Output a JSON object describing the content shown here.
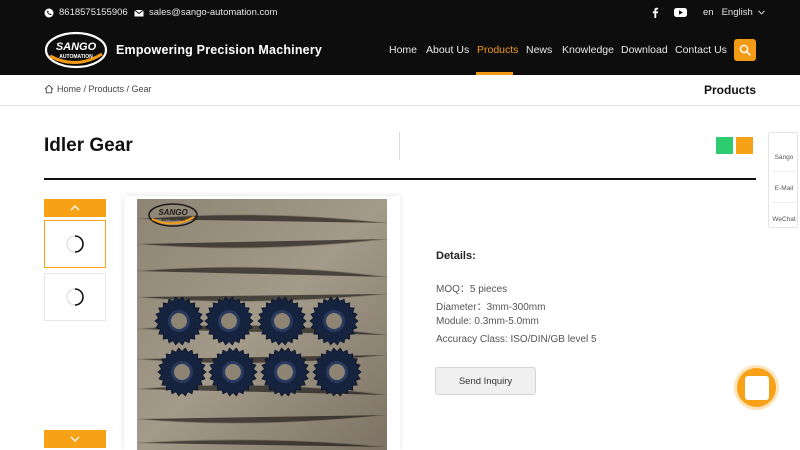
{
  "topbar": {
    "phone": "8618575155906",
    "email": "sales@sango-automation.com",
    "lang_code": "en",
    "lang_label": "English"
  },
  "brand": {
    "logo_text_top": "SANGO",
    "logo_text_bottom": "AUTOMATION",
    "slogan": "Empowering Precision Machinery",
    "accent_color": "#f49b16"
  },
  "nav": {
    "items": [
      "Home",
      "About Us",
      "Products",
      "News",
      "Knowledge",
      "Download",
      "Contact Us"
    ],
    "active": "Products"
  },
  "breadcrumb": {
    "path": "Home / Products / Gear",
    "section_title": "Products"
  },
  "product": {
    "title": "Idler Gear",
    "details_heading": "Details:",
    "specs": [
      "MOQ：5 pieces",
      "Diameter：3mm-300mm",
      "Module: 0.3mm-5.0mm",
      "Accuracy Class: ISO/DIN/GB level 5"
    ],
    "inquiry_label": "Send Inquiry",
    "share_colors": [
      "#2ecc71",
      "#f7a117"
    ]
  },
  "side_panel": {
    "items": [
      "Sango",
      "E-Mail",
      "WeChat"
    ]
  },
  "icons": {
    "phone": "whatsapp-icon",
    "email": "mail-icon",
    "facebook": "facebook-icon",
    "youtube": "youtube-icon",
    "search": "search-icon",
    "home": "home-icon",
    "up": "chevron-up-icon",
    "down": "chevron-down-icon"
  }
}
